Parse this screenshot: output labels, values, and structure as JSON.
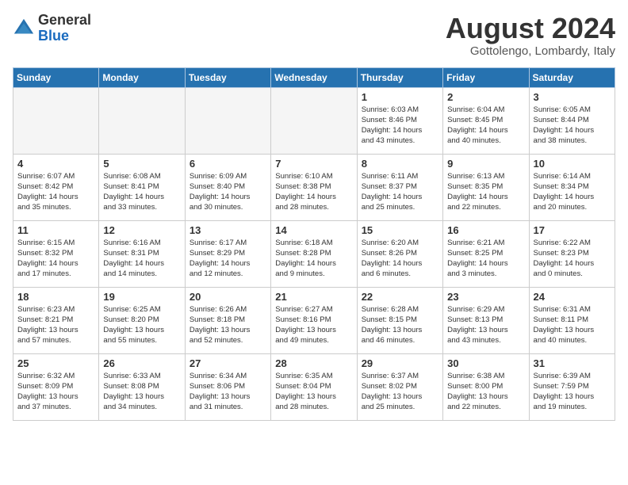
{
  "header": {
    "logo_line1": "General",
    "logo_line2": "Blue",
    "title": "August 2024",
    "subtitle": "Gottolengo, Lombardy, Italy"
  },
  "weekdays": [
    "Sunday",
    "Monday",
    "Tuesday",
    "Wednesday",
    "Thursday",
    "Friday",
    "Saturday"
  ],
  "weeks": [
    [
      {
        "day": "",
        "info": ""
      },
      {
        "day": "",
        "info": ""
      },
      {
        "day": "",
        "info": ""
      },
      {
        "day": "",
        "info": ""
      },
      {
        "day": "1",
        "info": "Sunrise: 6:03 AM\nSunset: 8:46 PM\nDaylight: 14 hours\nand 43 minutes."
      },
      {
        "day": "2",
        "info": "Sunrise: 6:04 AM\nSunset: 8:45 PM\nDaylight: 14 hours\nand 40 minutes."
      },
      {
        "day": "3",
        "info": "Sunrise: 6:05 AM\nSunset: 8:44 PM\nDaylight: 14 hours\nand 38 minutes."
      }
    ],
    [
      {
        "day": "4",
        "info": "Sunrise: 6:07 AM\nSunset: 8:42 PM\nDaylight: 14 hours\nand 35 minutes."
      },
      {
        "day": "5",
        "info": "Sunrise: 6:08 AM\nSunset: 8:41 PM\nDaylight: 14 hours\nand 33 minutes."
      },
      {
        "day": "6",
        "info": "Sunrise: 6:09 AM\nSunset: 8:40 PM\nDaylight: 14 hours\nand 30 minutes."
      },
      {
        "day": "7",
        "info": "Sunrise: 6:10 AM\nSunset: 8:38 PM\nDaylight: 14 hours\nand 28 minutes."
      },
      {
        "day": "8",
        "info": "Sunrise: 6:11 AM\nSunset: 8:37 PM\nDaylight: 14 hours\nand 25 minutes."
      },
      {
        "day": "9",
        "info": "Sunrise: 6:13 AM\nSunset: 8:35 PM\nDaylight: 14 hours\nand 22 minutes."
      },
      {
        "day": "10",
        "info": "Sunrise: 6:14 AM\nSunset: 8:34 PM\nDaylight: 14 hours\nand 20 minutes."
      }
    ],
    [
      {
        "day": "11",
        "info": "Sunrise: 6:15 AM\nSunset: 8:32 PM\nDaylight: 14 hours\nand 17 minutes."
      },
      {
        "day": "12",
        "info": "Sunrise: 6:16 AM\nSunset: 8:31 PM\nDaylight: 14 hours\nand 14 minutes."
      },
      {
        "day": "13",
        "info": "Sunrise: 6:17 AM\nSunset: 8:29 PM\nDaylight: 14 hours\nand 12 minutes."
      },
      {
        "day": "14",
        "info": "Sunrise: 6:18 AM\nSunset: 8:28 PM\nDaylight: 14 hours\nand 9 minutes."
      },
      {
        "day": "15",
        "info": "Sunrise: 6:20 AM\nSunset: 8:26 PM\nDaylight: 14 hours\nand 6 minutes."
      },
      {
        "day": "16",
        "info": "Sunrise: 6:21 AM\nSunset: 8:25 PM\nDaylight: 14 hours\nand 3 minutes."
      },
      {
        "day": "17",
        "info": "Sunrise: 6:22 AM\nSunset: 8:23 PM\nDaylight: 14 hours\nand 0 minutes."
      }
    ],
    [
      {
        "day": "18",
        "info": "Sunrise: 6:23 AM\nSunset: 8:21 PM\nDaylight: 13 hours\nand 57 minutes."
      },
      {
        "day": "19",
        "info": "Sunrise: 6:25 AM\nSunset: 8:20 PM\nDaylight: 13 hours\nand 55 minutes."
      },
      {
        "day": "20",
        "info": "Sunrise: 6:26 AM\nSunset: 8:18 PM\nDaylight: 13 hours\nand 52 minutes."
      },
      {
        "day": "21",
        "info": "Sunrise: 6:27 AM\nSunset: 8:16 PM\nDaylight: 13 hours\nand 49 minutes."
      },
      {
        "day": "22",
        "info": "Sunrise: 6:28 AM\nSunset: 8:15 PM\nDaylight: 13 hours\nand 46 minutes."
      },
      {
        "day": "23",
        "info": "Sunrise: 6:29 AM\nSunset: 8:13 PM\nDaylight: 13 hours\nand 43 minutes."
      },
      {
        "day": "24",
        "info": "Sunrise: 6:31 AM\nSunset: 8:11 PM\nDaylight: 13 hours\nand 40 minutes."
      }
    ],
    [
      {
        "day": "25",
        "info": "Sunrise: 6:32 AM\nSunset: 8:09 PM\nDaylight: 13 hours\nand 37 minutes."
      },
      {
        "day": "26",
        "info": "Sunrise: 6:33 AM\nSunset: 8:08 PM\nDaylight: 13 hours\nand 34 minutes."
      },
      {
        "day": "27",
        "info": "Sunrise: 6:34 AM\nSunset: 8:06 PM\nDaylight: 13 hours\nand 31 minutes."
      },
      {
        "day": "28",
        "info": "Sunrise: 6:35 AM\nSunset: 8:04 PM\nDaylight: 13 hours\nand 28 minutes."
      },
      {
        "day": "29",
        "info": "Sunrise: 6:37 AM\nSunset: 8:02 PM\nDaylight: 13 hours\nand 25 minutes."
      },
      {
        "day": "30",
        "info": "Sunrise: 6:38 AM\nSunset: 8:00 PM\nDaylight: 13 hours\nand 22 minutes."
      },
      {
        "day": "31",
        "info": "Sunrise: 6:39 AM\nSunset: 7:59 PM\nDaylight: 13 hours\nand 19 minutes."
      }
    ]
  ]
}
